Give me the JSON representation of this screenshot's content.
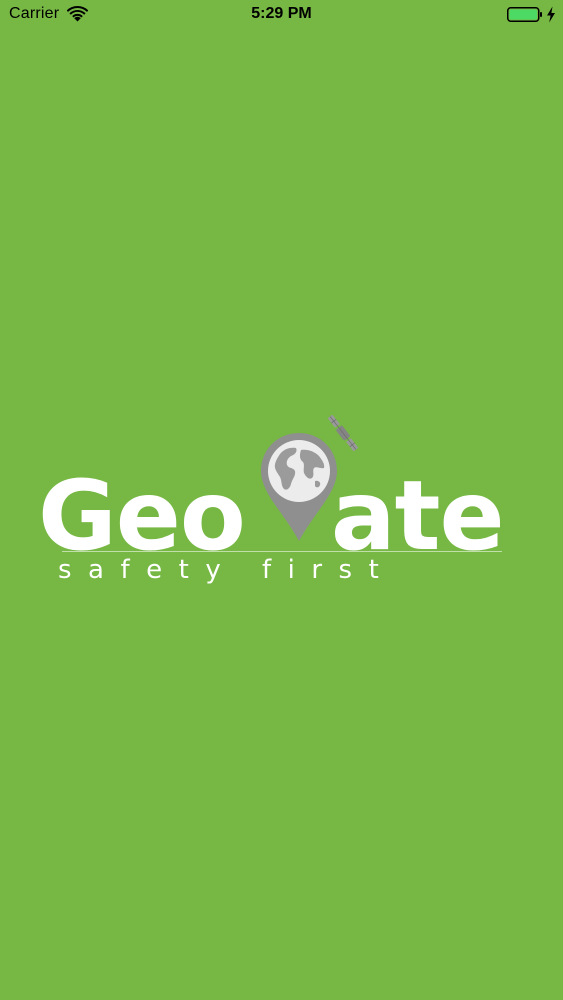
{
  "status_bar": {
    "carrier": "Carrier",
    "time": "5:29 PM",
    "wifi_icon": "wifi-icon",
    "battery_icon": "battery-charging-icon",
    "battery_color": "#4cd964"
  },
  "splash": {
    "background_color": "#76b843",
    "logo": {
      "word_part_1": "Geo",
      "word_part_2": "ate",
      "tagline": "safety first",
      "pin_icon": "globe-location-pin-icon",
      "satellite_icon": "satellite-icon",
      "text_color": "#ffffff",
      "pin_color": "#8f8f8f"
    }
  }
}
